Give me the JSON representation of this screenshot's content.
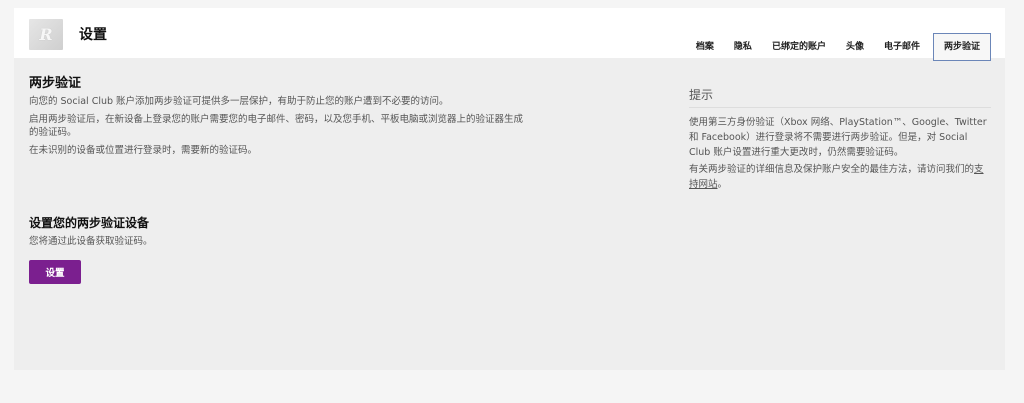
{
  "header": {
    "title": "设置",
    "avatar_letter": "R",
    "tabs": [
      {
        "label": "档案",
        "active": false
      },
      {
        "label": "隐私",
        "active": false
      },
      {
        "label": "已绑定的账户",
        "active": false
      },
      {
        "label": "头像",
        "active": false
      },
      {
        "label": "电子邮件",
        "active": false
      },
      {
        "label": "两步验证",
        "active": true
      }
    ]
  },
  "main": {
    "heading": "两步验证",
    "paragraphs": [
      "向您的 Social Club 账户添加两步验证可提供多一层保护，有助于防止您的账户遭到不必要的访问。",
      "启用两步验证后，在新设备上登录您的账户需要您的电子邮件、密码，以及您手机、平板电脑或浏览器上的验证器生成的验证码。",
      "在未识别的设备或位置进行登录时，需要新的验证码。"
    ],
    "setup": {
      "heading": "设置您的两步验证设备",
      "description": "您将通过此设备获取验证码。",
      "button_label": "设置"
    }
  },
  "tips": {
    "title": "提示",
    "paragraph1": "使用第三方身份验证（Xbox 网络、PlayStation™、Google、Twitter 和 Facebook）进行登录将不需要进行两步验证。但是，对 Social Club 账户设置进行重大更改时，仍然需要验证码。",
    "paragraph2_prefix": "有关两步验证的详细信息及保护账户安全的最佳方法，请访问我们的",
    "support_link": "支持网站",
    "paragraph2_suffix": "。"
  },
  "colors": {
    "accent_button": "#7b1f8f",
    "active_tab_border": "#6b86b8"
  }
}
